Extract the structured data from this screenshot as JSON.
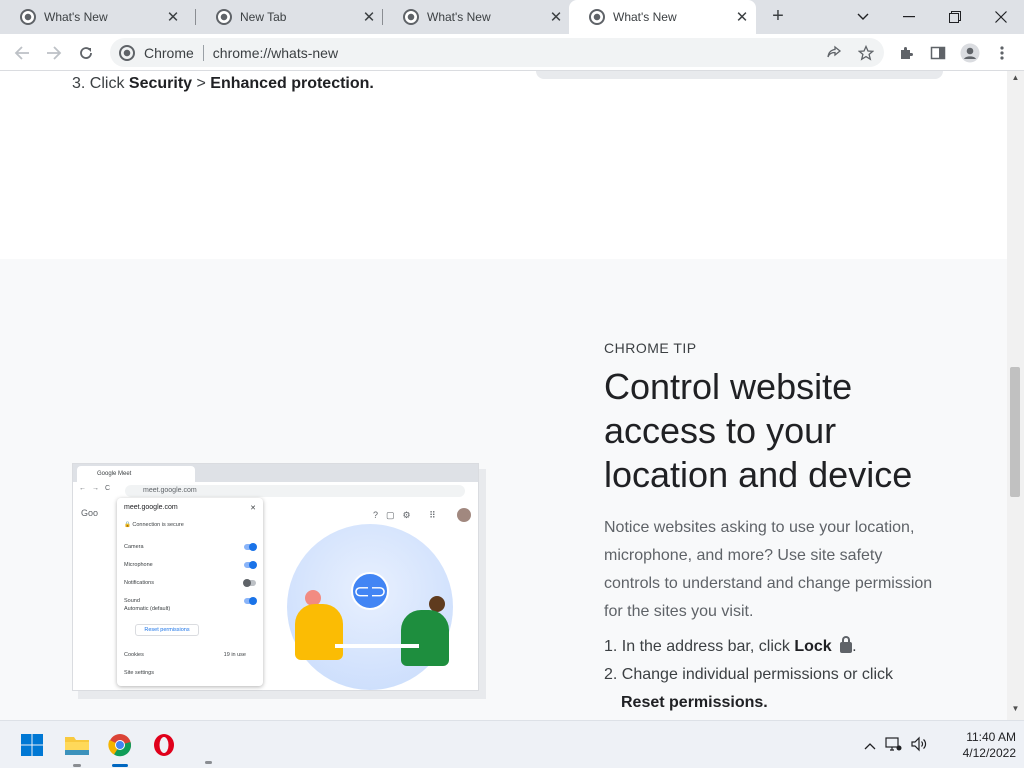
{
  "browser": {
    "tabs": [
      {
        "title": "What's New",
        "active": false
      },
      {
        "title": "New Tab",
        "active": false
      },
      {
        "title": "What's New",
        "active": false
      },
      {
        "title": "What's New",
        "active": true
      }
    ],
    "omnibox": {
      "site_label": "Chrome",
      "url": "chrome://whats-new"
    }
  },
  "page": {
    "step3": {
      "prefix": "3. Click ",
      "bold1": "Security",
      "sep": " > ",
      "bold2": "Enhanced protection."
    },
    "tip": {
      "label": "CHROME TIP",
      "title": "Control website access to your location and device",
      "body": "Notice websites asking to use your location, microphone, and more? Use site safety controls to understand and change permission for the sites you visit.",
      "step1": {
        "prefix": "1. In the address bar, click ",
        "bold": "Lock",
        "suffix": "."
      },
      "step2": {
        "text": "2. Change individual permissions or click",
        "bold": "Reset permissions."
      }
    },
    "illustration": {
      "tab_title": "Google Meet",
      "url": "meet.google.com",
      "popup_title": "meet.google.com",
      "connection": "Connection is secure",
      "rows": [
        {
          "label": "Camera",
          "on": true
        },
        {
          "label": "Microphone",
          "on": true
        },
        {
          "label": "Notifications",
          "on": false
        },
        {
          "label": "Sound",
          "sub": "Automatic (default)",
          "on": true
        }
      ],
      "reset_button": "Reset permissions",
      "cookies": "Cookies",
      "cookies_count": "19 in use",
      "site_settings": "Site settings",
      "app_name_fragment": "Goo"
    }
  },
  "taskbar": {
    "time": "11:40 AM",
    "date": "4/12/2022"
  }
}
